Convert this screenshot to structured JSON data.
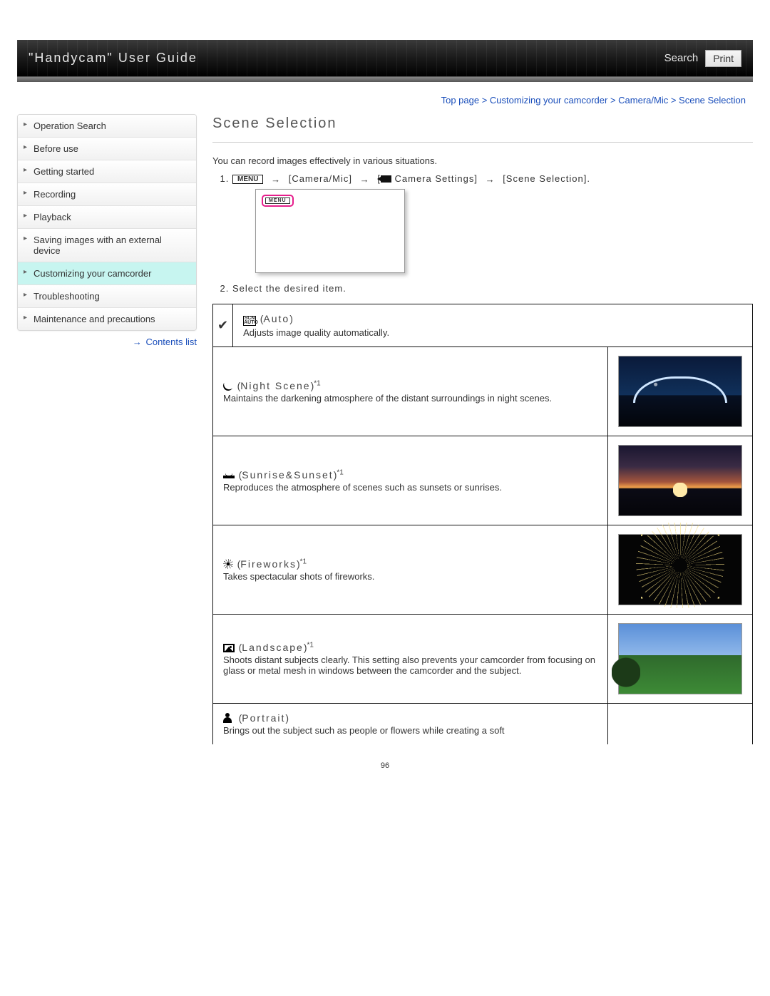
{
  "header": {
    "title": "\"Handycam\" User Guide",
    "search": "Search",
    "print": "Print"
  },
  "breadcrumb": "Top page > Customizing your camcorder > Camera/Mic > Scene Selection",
  "sidebar": {
    "items": [
      {
        "label": "Operation Search"
      },
      {
        "label": "Before use"
      },
      {
        "label": "Getting started"
      },
      {
        "label": "Recording"
      },
      {
        "label": "Playback"
      },
      {
        "label": "Saving images with an external device"
      },
      {
        "label": "Customizing your camcorder"
      },
      {
        "label": "Troubleshooting"
      },
      {
        "label": "Maintenance and precautions"
      }
    ],
    "active_index": 6,
    "contents_link": "Contents list"
  },
  "main": {
    "title": "Scene Selection",
    "intro": "You can record images effectively in various situations.",
    "step1": {
      "menu": "MENU",
      "p1": "[Camera/Mic]",
      "p2_prefix": "[",
      "p2_label": "Camera Settings]",
      "p3": "[Scene Selection]."
    },
    "menu_small": "MENU",
    "step2": "Select the desired item.",
    "rows": [
      {
        "name": "Auto",
        "sup": "",
        "paren_l": "(",
        "paren_r": ")",
        "desc": "Adjusts image quality automatically."
      },
      {
        "name": "Night Scene",
        "sup": "*1",
        "paren_l": "(",
        "paren_r": ")",
        "desc": "Maintains the darkening atmosphere of the distant surroundings in night scenes."
      },
      {
        "name": "Sunrise&Sunset",
        "sup": "*1",
        "paren_l": "(",
        "paren_r": ")",
        "desc": "Reproduces the atmosphere of scenes such as sunsets or sunrises."
      },
      {
        "name": "Fireworks",
        "sup": "*1",
        "paren_l": "(",
        "paren_r": ")",
        "desc": "Takes spectacular shots of fireworks."
      },
      {
        "name": "Landscape",
        "sup": "*1",
        "paren_l": "(",
        "paren_r": ")",
        "desc": "Shoots distant subjects clearly. This setting also prevents your camcorder from focusing on glass or metal mesh in windows between the camcorder and the subject."
      },
      {
        "name": "Portrait",
        "sup": "",
        "paren_l": "(",
        "paren_r": ")",
        "desc": "Brings out the subject such as people or flowers while creating a soft"
      }
    ],
    "check": "✔"
  },
  "page_number": "96"
}
